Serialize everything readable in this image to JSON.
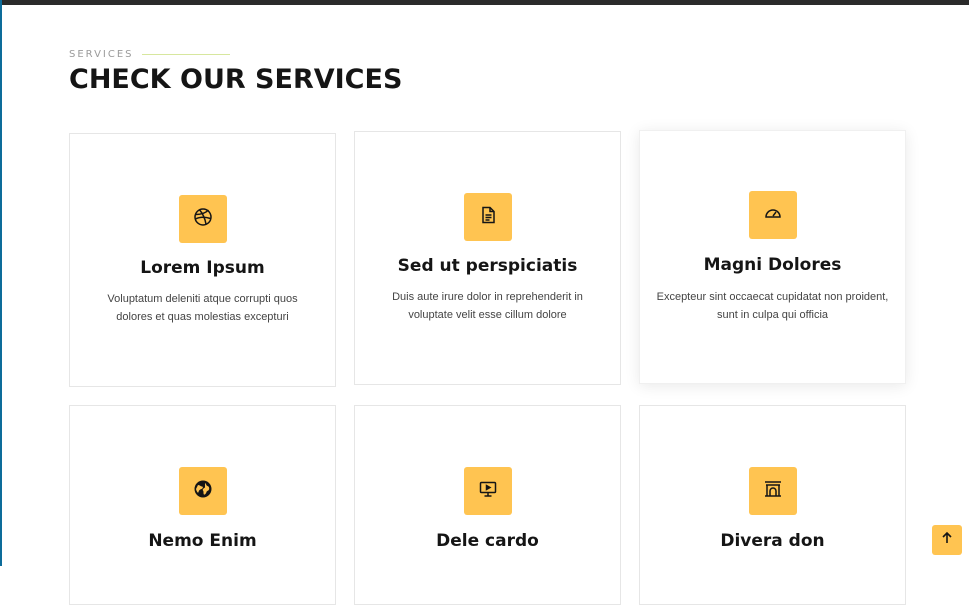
{
  "section": {
    "kicker": "SERVICES",
    "title": "CHECK OUR SERVICES"
  },
  "colors": {
    "accent": "#ffc451",
    "heading": "#151515",
    "kicker_line": "#d7e79e",
    "topbar": "#2b2b2b"
  },
  "services": [
    {
      "icon": "dribbble-icon",
      "title": "Lorem Ipsum",
      "text_line1": "Voluptatum deleniti atque corrupti quos",
      "text_line2": "dolores et quas molestias excepturi"
    },
    {
      "icon": "file-text-icon",
      "title": "Sed ut perspiciatis",
      "text_line1": "Duis aute irure dolor in reprehenderit in",
      "text_line2": "voluptate velit esse cillum dolore"
    },
    {
      "icon": "speedometer-icon",
      "title": "Magni Dolores",
      "text_line1": "Excepteur sint occaecat cupidatat non proident,",
      "text_line2": "sunt in culpa qui officia"
    },
    {
      "icon": "globe-icon",
      "title": "Nemo Enim"
    },
    {
      "icon": "presentation-icon",
      "title": "Dele cardo"
    },
    {
      "icon": "archway-icon",
      "title": "Divera don"
    }
  ],
  "scroll_top": {
    "icon": "arrow-up-icon"
  }
}
